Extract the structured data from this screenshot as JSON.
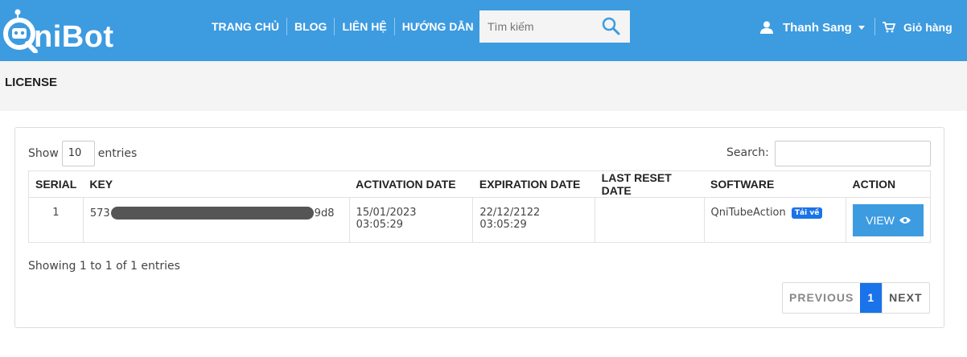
{
  "brand": {
    "name": "QniBot",
    "logo_text": "niBot"
  },
  "nav": {
    "items": [
      "TRANG CHỦ",
      "BLOG",
      "LIÊN HỆ",
      "HƯỚNG DẪN"
    ]
  },
  "search": {
    "placeholder": "Tìm kiếm"
  },
  "user": {
    "name": "Thanh Sang"
  },
  "cart": {
    "label": "Giỏ hàng"
  },
  "page": {
    "title": "LICENSE"
  },
  "table_controls": {
    "show_label": "Show",
    "entries_value": "10",
    "entries_label": "entries",
    "search_label": "Search:"
  },
  "table": {
    "headers": [
      "SERIAL",
      "KEY",
      "ACTIVATION DATE",
      "EXPIRATION DATE",
      "LAST RESET DATE",
      "SOFTWARE",
      "ACTION"
    ],
    "rows": [
      {
        "serial": "1",
        "key_prefix": "573",
        "key_suffix": "9d8",
        "activation_date": "15/01/2023 03:05:29",
        "expiration_date": "22/12/2122 03:05:29",
        "last_reset_date": "",
        "software": "QniTubeAction",
        "software_badge": "Tải về",
        "action_label": "VIEW"
      }
    ]
  },
  "footer": {
    "info": "Showing 1 to 1 of 1 entries",
    "previous": "PREVIOUS",
    "page": "1",
    "next": "NEXT"
  },
  "colors": {
    "primary": "#3d9be0",
    "accent": "#1a73e8"
  }
}
